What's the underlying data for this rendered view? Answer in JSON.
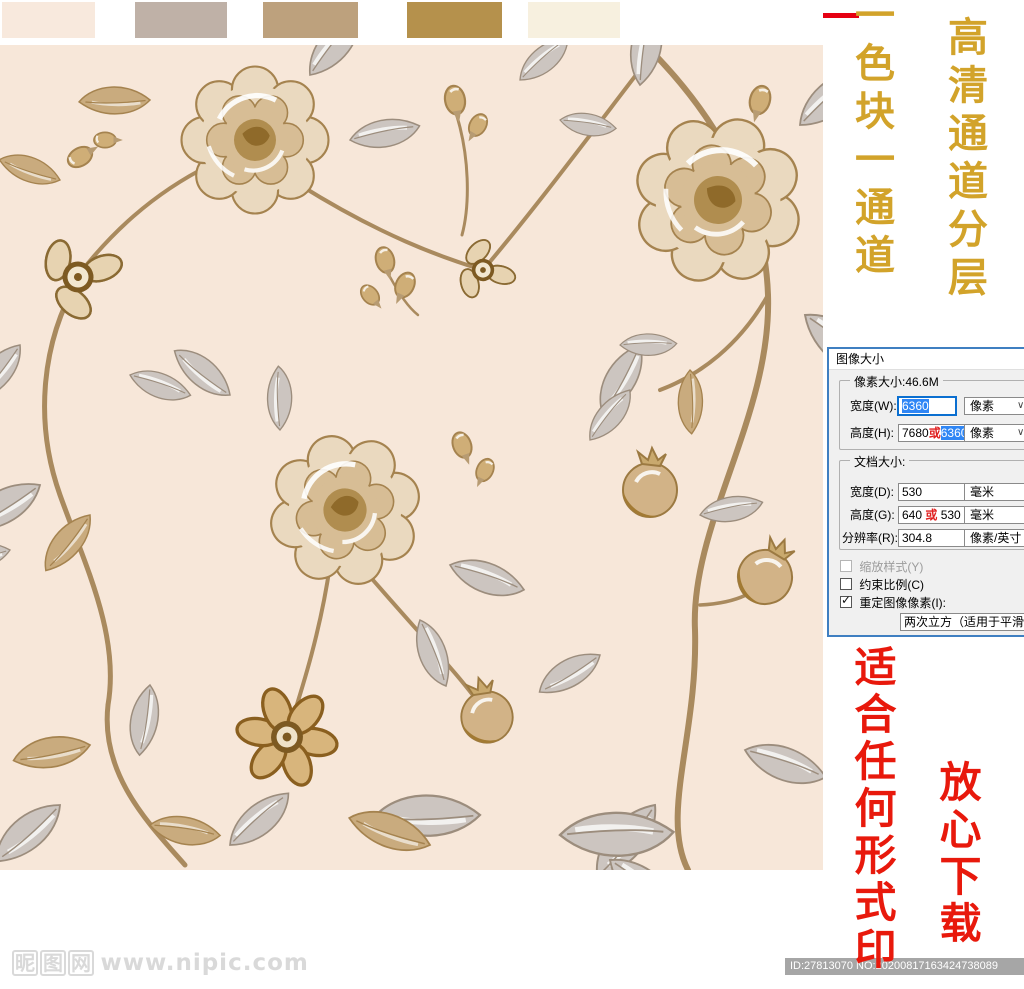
{
  "swatches": [
    {
      "name": "cream-pink",
      "color": "#f8e9dd"
    },
    {
      "name": "warm-gray",
      "color": "#bfb1a7"
    },
    {
      "name": "tan",
      "color": "#bda17d"
    },
    {
      "name": "gold",
      "color": "#b5914c"
    },
    {
      "name": "light-cream",
      "color": "#f7f0df"
    }
  ],
  "pattern": {
    "background": "#f7e7d9",
    "palette": {
      "outline_brown": "#a5834f",
      "dark_gold": "#8f6a2a",
      "tan_petal": "#d7bd95",
      "cream_petal": "#ead9bf",
      "gray_leaf": "#ccc5c0",
      "stem": "#a98a5e",
      "white": "#ffffff"
    }
  },
  "annotations": {
    "gold_column_1": "一色块一通道",
    "gold_column_2": "高清通道分层",
    "red_column_1": "适合任何形式印",
    "red_column_2": "放心下载",
    "gold_color": "#d2a32a",
    "red_color": "#e8190c"
  },
  "dialog": {
    "title": "图像大小",
    "pixel_legend": "像素大小:46.6M",
    "width_label": "宽度(W):",
    "width_value": "6360",
    "width_unit": "像素",
    "height_label": "高度(H):",
    "height_value_prefix": "7680",
    "or_char": "或",
    "height_value_selected": "6360",
    "height_unit": "像素",
    "doc_legend": "文档大小:",
    "doc_width_label": "宽度(D):",
    "doc_width_value": "530",
    "doc_width_unit": "毫米",
    "doc_height_label": "高度(G):",
    "doc_height_prefix": "640 ",
    "doc_height_suffix": " 530",
    "doc_height_unit": "毫米",
    "res_label": "分辨率(R):",
    "res_value": "304.8",
    "res_unit": "像素/英寸",
    "checkboxes": [
      {
        "label": "缩放样式(Y)",
        "checked": false,
        "disabled": true
      },
      {
        "label": "约束比例(C)",
        "checked": false,
        "disabled": false
      },
      {
        "label": "重定图像像素(I):",
        "checked": true,
        "disabled": false
      }
    ],
    "resample_method": "两次立方（适用于平滑渐变"
  },
  "icons": {
    "dropdown_chevron": "∨",
    "checkmark": "✓"
  },
  "footer": {
    "watermark_chars": [
      "昵",
      "图",
      "网"
    ],
    "watermark_url": "www.nipic.com",
    "id_text": "ID:27813070 NO:20200817163424738089"
  }
}
